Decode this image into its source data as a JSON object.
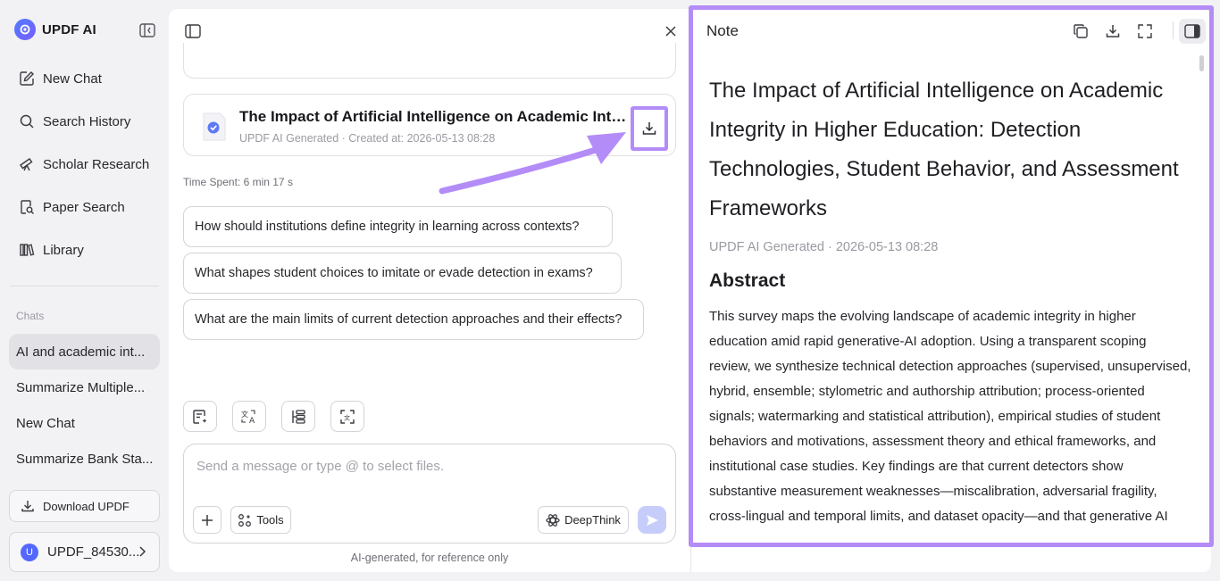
{
  "sidebar": {
    "brand": "UPDF AI",
    "nav": [
      {
        "label": "New Chat",
        "icon": "edit-icon"
      },
      {
        "label": "Search History",
        "icon": "search-icon"
      },
      {
        "label": "Scholar Research",
        "icon": "telescope-icon"
      },
      {
        "label": "Paper Search",
        "icon": "document-search-icon"
      },
      {
        "label": "Library",
        "icon": "library-icon"
      }
    ],
    "chats_label": "Chats",
    "chats": [
      {
        "label": "AI and academic int...",
        "active": true
      },
      {
        "label": "Summarize Multiple...",
        "active": false
      },
      {
        "label": "New Chat",
        "active": false
      },
      {
        "label": "Summarize Bank Sta...",
        "active": false
      }
    ],
    "download_label": "Download UPDF",
    "user": {
      "avatar_letter": "U",
      "name": "UPDF_84530..."
    }
  },
  "chat": {
    "doc_card": {
      "title": "The Impact of Artificial Intelligence on Academic Integrity in Higher Education: Detection Technologies, Student Behavior, and Assessment Frameworks",
      "meta": "UPDF AI Generated · Created at: 2026-05-13 08:28"
    },
    "time_spent": "Time Spent: 6 min 17 s",
    "suggestions": [
      "How should institutions define integrity in learning across contexts?",
      "What shapes student choices to imitate or evade detection in exams?",
      "What are the main limits of current detection approaches and their effects?"
    ],
    "composer": {
      "placeholder": "Send a message or type @ to select files.",
      "tools_label": "Tools",
      "deepthink_label": "DeepThink"
    },
    "disclaimer": "AI-generated, for reference only"
  },
  "note": {
    "header": "Note",
    "title": "The Impact of Artificial Intelligence on Academic Integrity in Higher Education: Detection Technologies, Student Behavior, and Assessment Frameworks",
    "meta": "UPDF AI Generated · 2026-05-13 08:28",
    "abstract_heading": "Abstract",
    "abstract": "This survey maps the evolving landscape of academic integrity in higher education amid rapid generative-AI adoption. Using a transparent scoping review, we synthesize technical detection approaches (supervised, unsupervised, hybrid, ensemble; stylometric and authorship attribution; process-oriented signals; watermarking and statistical attribution), empirical studies of student behaviors and motivations, assessment theory and ethical frameworks, and institutional case studies. Key findings are that current detectors show substantive measurement weaknesses—miscalibration, adversarial fragility, cross-lingual and temporal limits, and dataset opacity—and that generative AI"
  },
  "colors": {
    "highlight": "#b48cf7",
    "accent": "#5468ff",
    "send_disabled": "#c7cdfb"
  }
}
